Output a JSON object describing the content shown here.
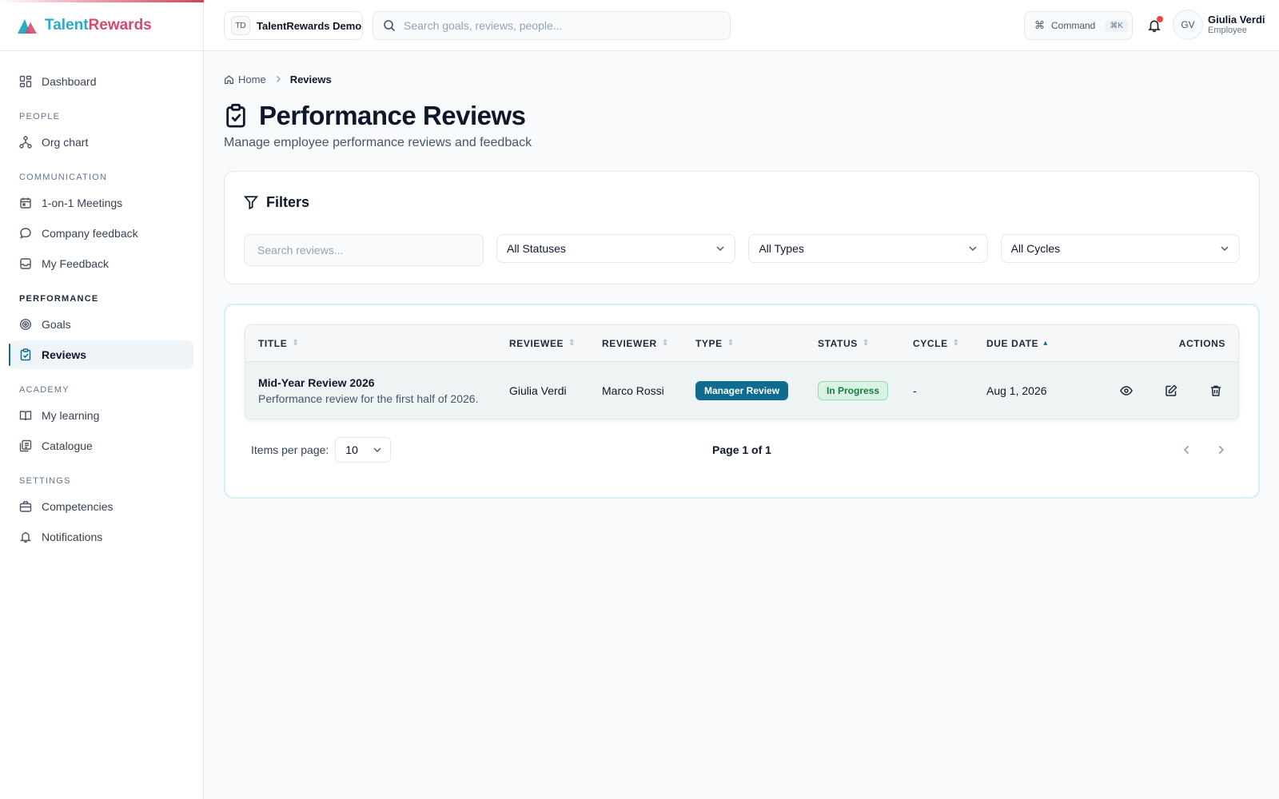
{
  "brand": {
    "name_part1": "Talent",
    "name_part2": "Rewards",
    "accent": "#2aa9c9",
    "brand2": "#d54a6a"
  },
  "header": {
    "workspace_badge": "TD",
    "workspace_name": "TalentRewards Demo",
    "search_placeholder": "Search goals, reviews, people...",
    "command_label": "Command",
    "command_shortcut": "⌘K",
    "user": {
      "initials": "GV",
      "name": "Giulia Verdi",
      "role": "Employee"
    }
  },
  "sidebar": {
    "dashboard": "Dashboard",
    "sections": {
      "people": "PEOPLE",
      "communication": "COMMUNICATION",
      "performance": "PERFORMANCE",
      "academy": "ACADEMY",
      "settings": "SETTINGS"
    },
    "items": {
      "org_chart": "Org chart",
      "meetings": "1-on-1 Meetings",
      "company_feedback": "Company feedback",
      "my_feedback": "My Feedback",
      "goals": "Goals",
      "reviews": "Reviews",
      "my_learning": "My learning",
      "catalogue": "Catalogue",
      "competencies": "Competencies",
      "notifications": "Notifications"
    }
  },
  "breadcrumb": {
    "home": "Home",
    "current": "Reviews"
  },
  "page": {
    "title": "Performance Reviews",
    "subtitle": "Manage employee performance reviews and feedback"
  },
  "filters": {
    "heading": "Filters",
    "search_placeholder": "Search reviews...",
    "status_value": "All Statuses",
    "type_value": "All Types",
    "cycle_value": "All Cycles"
  },
  "table": {
    "headers": {
      "title": "TITLE",
      "reviewee": "REVIEWEE",
      "reviewer": "REVIEWER",
      "type": "TYPE",
      "status": "STATUS",
      "cycle": "CYCLE",
      "due_date": "DUE DATE",
      "actions": "ACTIONS"
    },
    "rows": [
      {
        "title": "Mid-Year Review 2026",
        "description": "Performance review for the first half of 2026.",
        "reviewee": "Giulia Verdi",
        "reviewer": "Marco Rossi",
        "type": "Manager Review",
        "status": "In Progress",
        "cycle": "-",
        "due_date": "Aug 1, 2026"
      }
    ]
  },
  "pagination": {
    "items_per_page_label": "Items per page:",
    "items_per_page_value": "10",
    "page_info": "Page 1 of 1"
  }
}
